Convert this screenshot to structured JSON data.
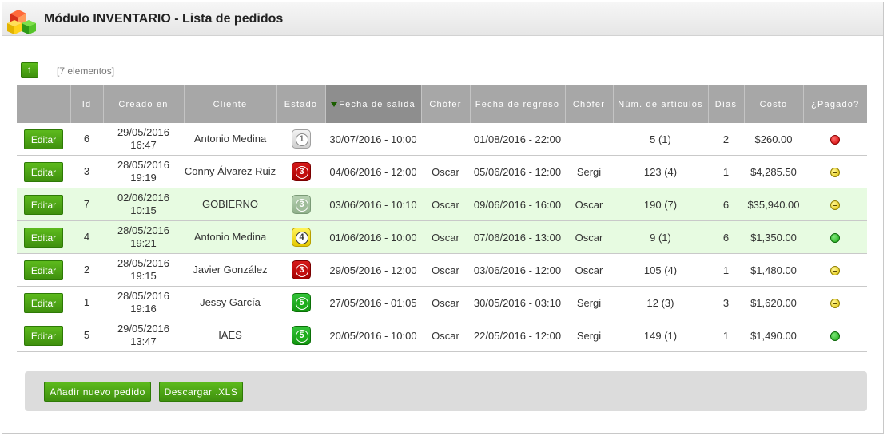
{
  "header": {
    "title": "Módulo INVENTARIO - Lista de pedidos",
    "logo_icon": "inventory-boxes-icon"
  },
  "pagination": {
    "current_page": "1",
    "count_text": "[7 elementos]"
  },
  "table": {
    "columns": [
      "",
      "Id",
      "Creado en",
      "Cliente",
      "Estado",
      "Fecha de salida",
      "Chófer",
      "Fecha de regreso",
      "Chófer",
      "Núm. de artículos",
      "Días",
      "Costo",
      "¿Pagado?"
    ],
    "rows": [
      {
        "action": "Editar",
        "id": "6",
        "created_date": "29/05/2016",
        "created_time": "16:47",
        "client": "Antonio Medina",
        "state": "1",
        "state_color": "gray",
        "departure": "30/07/2016 - 10:00",
        "driver_out": "",
        "return": "01/08/2016 - 22:00",
        "driver_back": "",
        "items": "5 (1)",
        "days": "2",
        "cost": "$260.00",
        "paid": "red",
        "highlight": false
      },
      {
        "action": "Editar",
        "id": "3",
        "created_date": "28/05/2016",
        "created_time": "19:19",
        "client": "Conny Álvarez Ruiz",
        "state": "3",
        "state_color": "red",
        "departure": "04/06/2016 - 12:00",
        "driver_out": "Oscar",
        "return": "05/06/2016 - 12:00",
        "driver_back": "Sergi",
        "items": "123 (4)",
        "days": "1",
        "cost": "$4,285.50",
        "paid": "yellow",
        "highlight": false
      },
      {
        "action": "Editar",
        "id": "7",
        "created_date": "02/06/2016",
        "created_time": "10:15",
        "client": "GOBIERNO",
        "state": "3",
        "state_color": "graygreen",
        "departure": "03/06/2016 - 10:10",
        "driver_out": "Oscar",
        "return": "09/06/2016 - 16:00",
        "driver_back": "Oscar",
        "items": "190 (7)",
        "days": "6",
        "cost": "$35,940.00",
        "paid": "yellow",
        "highlight": true
      },
      {
        "action": "Editar",
        "id": "4",
        "created_date": "28/05/2016",
        "created_time": "19:21",
        "client": "Antonio Medina",
        "state": "4",
        "state_color": "yellow",
        "departure": "01/06/2016 - 10:00",
        "driver_out": "Oscar",
        "return": "07/06/2016 - 13:00",
        "driver_back": "Oscar",
        "items": "9 (1)",
        "days": "6",
        "cost": "$1,350.00",
        "paid": "green",
        "highlight": true
      },
      {
        "action": "Editar",
        "id": "2",
        "created_date": "28/05/2016",
        "created_time": "19:15",
        "client": "Javier González",
        "state": "3",
        "state_color": "red",
        "departure": "29/05/2016 - 12:00",
        "driver_out": "Oscar",
        "return": "03/06/2016 - 12:00",
        "driver_back": "Oscar",
        "items": "105 (4)",
        "days": "1",
        "cost": "$1,480.00",
        "paid": "yellow",
        "highlight": false
      },
      {
        "action": "Editar",
        "id": "1",
        "created_date": "28/05/2016",
        "created_time": "19:16",
        "client": "Jessy García",
        "state": "5",
        "state_color": "green",
        "departure": "27/05/2016 - 01:05",
        "driver_out": "Oscar",
        "return": "30/05/2016 - 03:10",
        "driver_back": "Sergi",
        "items": "12 (3)",
        "days": "3",
        "cost": "$1,620.00",
        "paid": "yellow",
        "highlight": false
      },
      {
        "action": "Editar",
        "id": "5",
        "created_date": "29/05/2016",
        "created_time": "13:47",
        "client": "IAES",
        "state": "5",
        "state_color": "green",
        "departure": "20/05/2016 - 10:00",
        "driver_out": "Oscar",
        "return": "22/05/2016 - 12:00",
        "driver_back": "Sergi",
        "items": "149 (1)",
        "days": "1",
        "cost": "$1,490.00",
        "paid": "green",
        "highlight": false
      }
    ]
  },
  "footer": {
    "add_label": "Añadir nuevo pedido",
    "download_label": "Descargar .XLS"
  }
}
